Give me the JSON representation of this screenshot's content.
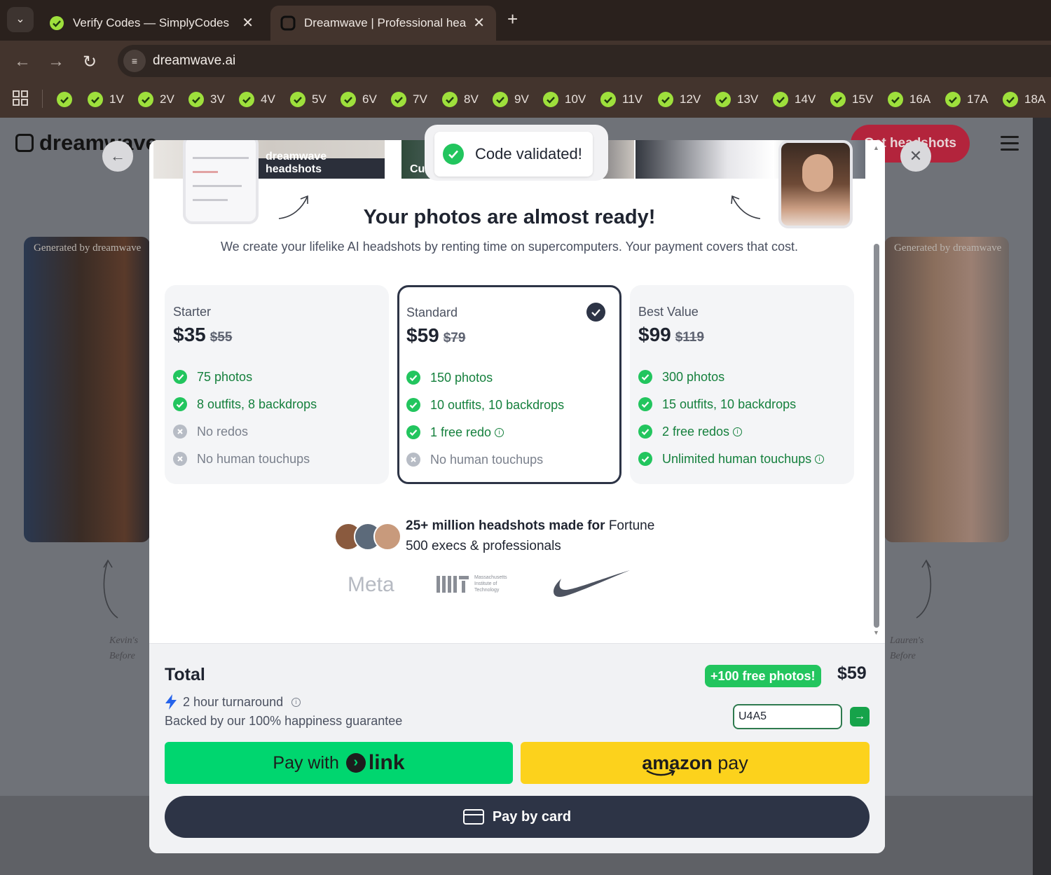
{
  "browser": {
    "tabs": [
      {
        "title": "Verify Codes — SimplyCodes",
        "active": false
      },
      {
        "title": "Dreamwave | Professional headshots",
        "active": true
      }
    ],
    "url": "dreamwave.ai",
    "bookmarks": [
      "1V",
      "2V",
      "3V",
      "4V",
      "5V",
      "6V",
      "7V",
      "8V",
      "9V",
      "10V",
      "11V",
      "12V",
      "13V",
      "14V",
      "15V",
      "16A",
      "17A",
      "18A"
    ]
  },
  "page": {
    "brand": "dreamwave",
    "cta": "Get headshots",
    "left_card": {
      "generated": "Generated by dreamwave",
      "before": [
        "Kevin's",
        "Before"
      ]
    },
    "right_card": {
      "generated": "Generated by dreamwave",
      "before": [
        "Lauren's",
        "Before"
      ]
    }
  },
  "toast": {
    "text": "Code validated!"
  },
  "modal": {
    "strip_labels": [
      "dreamwave headshots",
      "Custom"
    ],
    "title": "Your photos are almost ready!",
    "subtitle": "We create your lifelike AI headshots by renting time on supercomputers. Your payment covers that cost.",
    "plans": [
      {
        "name": "Starter",
        "price": "$35",
        "old_price": "$55",
        "selected": false,
        "features": [
          {
            "text": "75 photos",
            "included": true,
            "info": false
          },
          {
            "text": "8 outfits, 8 backdrops",
            "included": true,
            "info": false
          },
          {
            "text": "No redos",
            "included": false,
            "info": false
          },
          {
            "text": "No human touchups",
            "included": false,
            "info": false
          }
        ]
      },
      {
        "name": "Standard",
        "price": "$59",
        "old_price": "$79",
        "selected": true,
        "features": [
          {
            "text": "150 photos",
            "included": true,
            "info": false
          },
          {
            "text": "10 outfits, 10 backdrops",
            "included": true,
            "info": false
          },
          {
            "text": "1 free redo",
            "included": true,
            "info": true
          },
          {
            "text": "No human touchups",
            "included": false,
            "info": false
          }
        ]
      },
      {
        "name": "Best Value",
        "price": "$99",
        "old_price": "$119",
        "selected": false,
        "features": [
          {
            "text": "300 photos",
            "included": true,
            "info": false
          },
          {
            "text": "15 outfits, 10 backdrops",
            "included": true,
            "info": false
          },
          {
            "text": "2 free redos",
            "included": true,
            "info": true
          },
          {
            "text": "Unlimited human touchups",
            "included": true,
            "info": true
          }
        ]
      }
    ],
    "social_proof": {
      "bold": "25+ million headshots made for",
      "rest": "Fortune 500 execs & professionals"
    },
    "logos": {
      "meta": "Meta",
      "mit": [
        "Massachusetts",
        "Institute of",
        "Technology"
      ]
    },
    "footer": {
      "total_label": "Total",
      "turnaround": "2 hour turnaround",
      "guarantee": "Backed by our 100% happiness guarantee",
      "badge": "+100 free photos!",
      "total": "$59",
      "promo_code": "U4A5",
      "pay_link_prefix": "Pay with",
      "pay_link_brand": "link",
      "amazon_brand": "amazon",
      "amazon_suffix": "pay",
      "pay_card": "Pay by card"
    }
  },
  "colors": {
    "accent_green": "#22c55e",
    "navy": "#2d3446",
    "link_green": "#00d66f",
    "amazon_yellow": "#fcd21c",
    "cta_red": "#b3243c"
  }
}
